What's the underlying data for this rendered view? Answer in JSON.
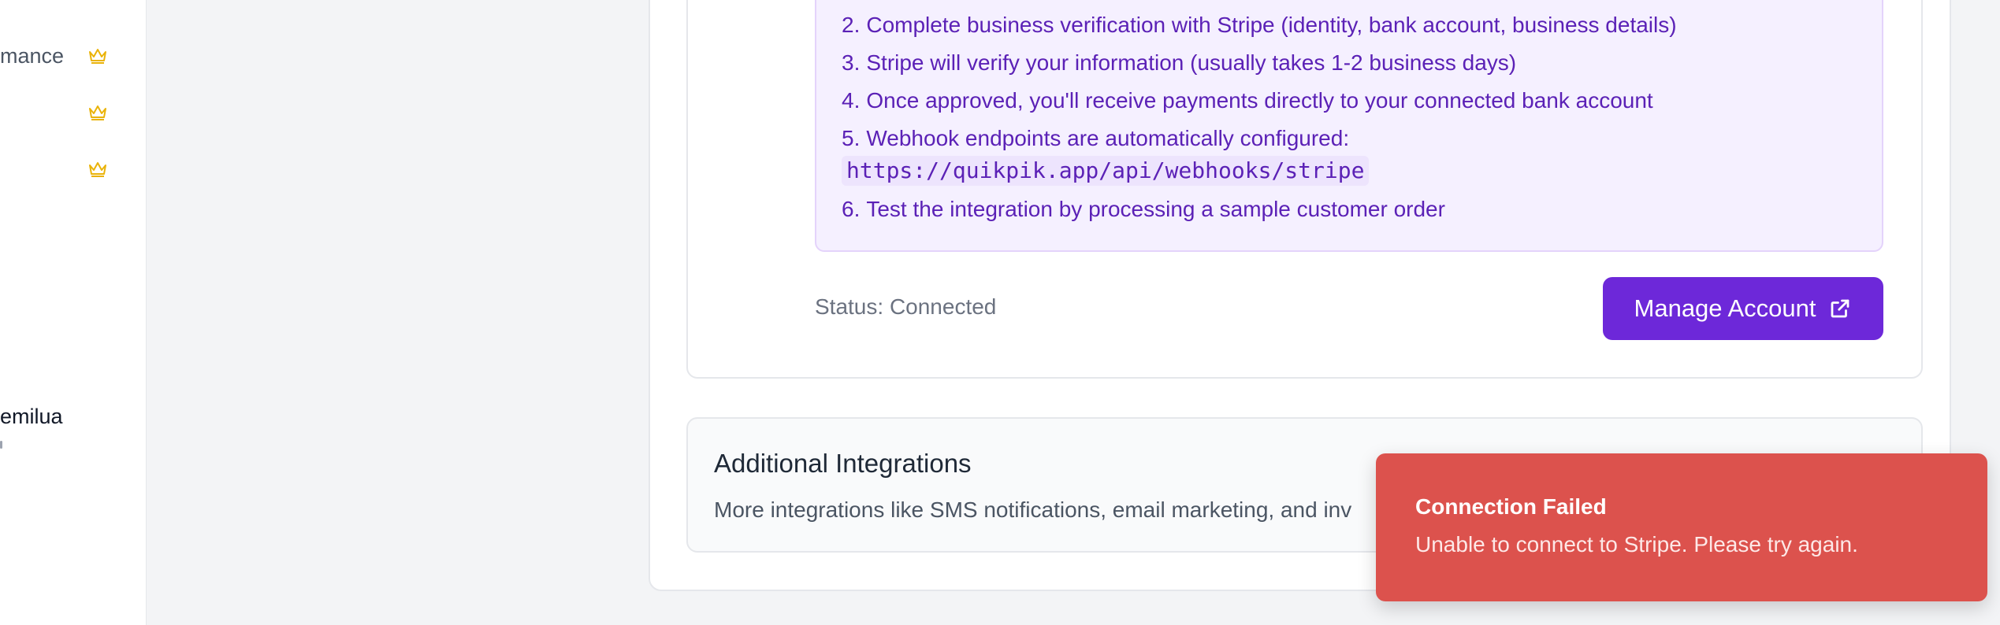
{
  "sidebar": {
    "items": [
      {
        "label": "mance",
        "badge_icon": "crown-icon"
      },
      {
        "label": "",
        "badge_icon": "crown-icon"
      },
      {
        "label": "",
        "badge_icon": "crown-icon"
      }
    ],
    "user": {
      "name": "emilua"
    }
  },
  "stripe_setup": {
    "steps": [
      {
        "num": "2.",
        "text": "Complete business verification with Stripe (identity, bank account, business details)"
      },
      {
        "num": "3.",
        "text": "Stripe will verify your information (usually takes 1-2 business days)"
      },
      {
        "num": "4.",
        "text": "Once approved, you'll receive payments directly to your connected bank account"
      },
      {
        "num": "5.",
        "text": "Webhook endpoints are automatically configured:"
      },
      {
        "num": "6.",
        "text": "Test the integration by processing a sample customer order"
      }
    ],
    "webhook_url": "https://quikpik.app/api/webhooks/stripe",
    "status": "Status: Connected",
    "manage_button": "Manage Account"
  },
  "additional_integrations": {
    "title": "Additional Integrations",
    "description": "More integrations like SMS notifications, email marketing, and inv"
  },
  "toast": {
    "title": "Connection Failed",
    "message": "Unable to connect to Stripe. Please try again."
  },
  "colors": {
    "accent": "#6d28d9",
    "toast_bg": "#dc524d",
    "crown": "#eab308"
  }
}
